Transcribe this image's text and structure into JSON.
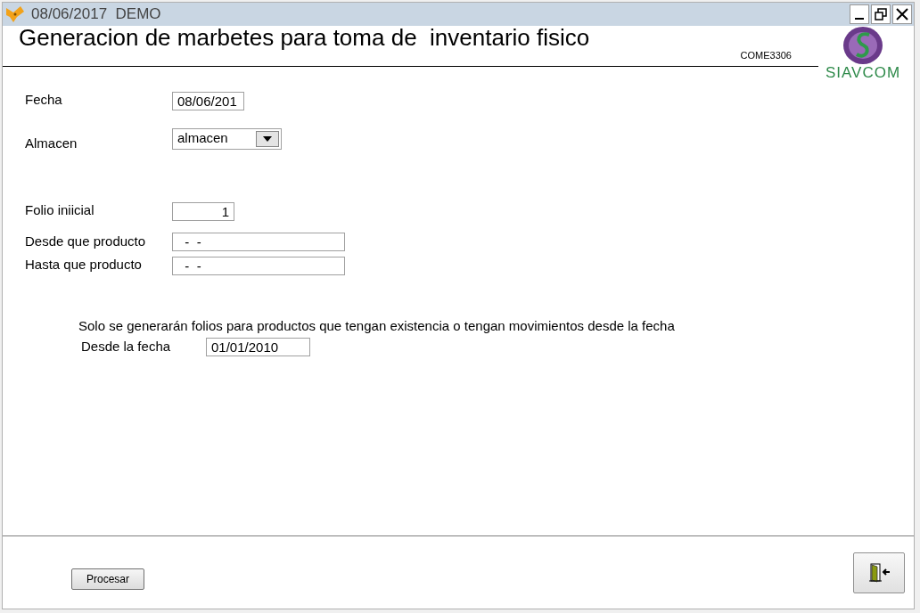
{
  "window": {
    "title": "08/06/2017  DEMO"
  },
  "header": {
    "title": "Generacion de marbetes para toma de  inventario fisico",
    "code": "COME3306",
    "logo_text": "SIAVCOM"
  },
  "form": {
    "fecha": {
      "label": "Fecha",
      "value": "08/06/201"
    },
    "almacen": {
      "label": "Almacen",
      "value": "almacen"
    },
    "folio": {
      "label": "Folio iniicial",
      "value": "1"
    },
    "desde_producto": {
      "label": "Desde que producto",
      "value": "  -  -"
    },
    "hasta_producto": {
      "label": "Hasta que producto",
      "value": "  -  -"
    }
  },
  "note": "Solo se generarán folios para productos que tengan existencia o tengan movimientos desde la fecha",
  "desde_fecha": {
    "label": "Desde la fecha",
    "value": "01/01/2010"
  },
  "buttons": {
    "process": "Procesar"
  }
}
